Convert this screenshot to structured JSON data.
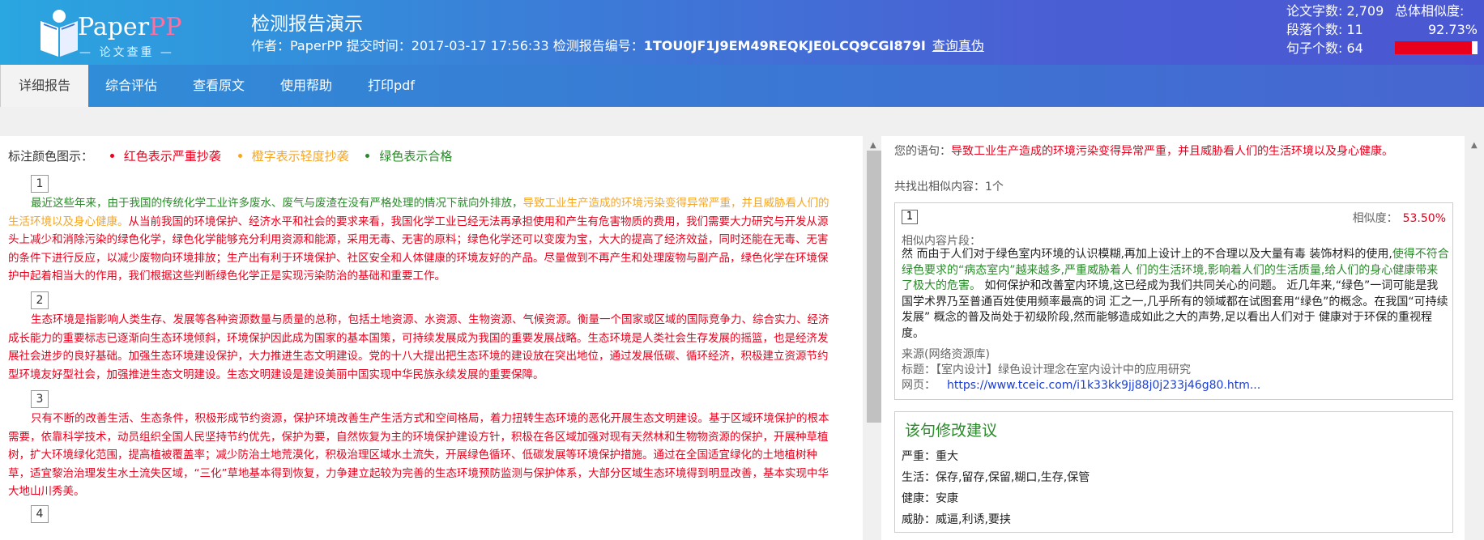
{
  "header": {
    "logo_brand_p": "P",
    "logo_brand_rest": "aper",
    "logo_brand_pp": "PP",
    "logo_tagline": "— 论文查重 —",
    "title": "检测报告演示",
    "meta_prefix": "作者：PaperPP 提交时间：2017-03-17 17:56:33 检测报告编号：",
    "report_id": "1TOU0JF1J9EM49REQKJE0LCQ9CGI879I",
    "verify_link": "查询真伪",
    "stats": {
      "word_count": "论文字数: 2,709",
      "paragraph_count": "段落个数: 11",
      "sentence_count": "句子个数: 64",
      "total_similarity_label": "总体相似度:",
      "total_similarity_value": "92.73%",
      "total_similarity_fraction": 0.9273
    },
    "colors": {
      "accent": "#3a78d4",
      "red": "#e8001c",
      "orange": "#f5a623",
      "green": "#2a8a2a"
    }
  },
  "nav": {
    "tabs": [
      "详细报告",
      "综合评估",
      "查看原文",
      "使用帮助",
      "打印pdf"
    ]
  },
  "legend": {
    "label": "标注颜色图示：",
    "red": "红色表示严重抄袭",
    "orange": "橙字表示轻度抄袭",
    "green": "绿色表示合格"
  },
  "paragraphs": [
    {
      "num": "1",
      "segments": [
        {
          "color": "green",
          "text": "最近这些年来，由于我国的传统化学工业许多废水、废气与废渣在没有严格处理的情况下就向外排放，"
        },
        {
          "color": "orange",
          "text": "导致工业生产造成的环境污染变得异常严重，并且威胁看人们的生活环境以及身心健康。"
        },
        {
          "color": "red",
          "text": "从当前我国的环境保护、经济水平和社会的要求来看，我国化学工业已经无法再承担使用和产生有危害物质的费用，我们需要大力研究与开发从源头上减少和消除污染的绿色化学，绿色化学能够充分利用资源和能源，采用无毒、无害的原料；绿色化学还可以变废为宝，大大的提高了经济效益，同时还能在无毒、无害的条件下进行反应，以减少废物向环境排放；生产出有利于环境保护、社区安全和人体健康的环境友好的产品。尽量做到不再产生和处理废物与副产品，绿色化学在环境保护中起着相当大的作用，我们根据这些判断绿色化学正是实现污染防治的基础和重要工作。"
        }
      ]
    },
    {
      "num": "2",
      "segments": [
        {
          "color": "red",
          "text": "生态环境是指影响人类生存、发展等各种资源数量与质量的总称，包括土地资源、水资源、生物资源、气候资源。衡量一个国家或区域的国际竞争力、综合实力、经济成长能力的重要标志已逐渐向生态环境倾斜，环境保护因此成为国家的基本国策，可持续发展成为我国的重要发展战略。生态环境是人类社会生存发展的摇篮，也是经济发展社会进步的良好基础。加强生态环境建设保护，大力推进生态文明建设。党的十八大提出把生态环境的建设放在突出地位，通过发展低碳、循环经济，积极建立资源节约型环境友好型社会，加强推进生态文明建设。生态文明建设是建设美丽中国实现中华民族永续发展的重要保障。"
        }
      ]
    },
    {
      "num": "3",
      "segments": [
        {
          "color": "red",
          "text": "只有不断的改善生活、生态条件，积极形成节约资源，保护环境改善生产生活方式和空间格局，着力扭转生态环境的恶化开展生态文明建设。基于区域环境保护的根本需要，依靠科学技术，动员组织全国人民坚持节约优先，保护为要，自然恢复为主的环境保护建设方针，积极在各区域加强对现有天然林和生物物资源的保护，开展种草植树，扩大环境绿化范围，提高植被覆盖率；减少防治土地荒漠化，积极治理区域水土流失，开展绿色循环、低碳发展等环境保护措施。通过在全国适宜绿化的土地植树种草，适宜黎治治理发生水土流失区域，“三化”草地基本得到恢复，力争建立起较为完善的生态环境预防监测与保护体系，大部分区域生态环境得到明显改善，基本实现中华大地山川秀美。"
        }
      ]
    },
    {
      "num": "4",
      "segments": []
    }
  ],
  "detail": {
    "sentence_label": "您的语句：",
    "sentence_text": "导致工业生产造成的环境污染变得异常严重，并且威胁看人们的生活环境以及身心健康。",
    "found_text": "共找出相似内容：1个",
    "match": {
      "num": "1",
      "similarity_label": "相似度：",
      "similarity_value": "53.50%",
      "fragment_label": "相似内容片段：",
      "fragment_segments": [
        {
          "color": "black",
          "text": "然 而由于人们对于绿色室内环境的认识模糊,再加上设计上的不合理以及大量有毒 装饰材料的使用,"
        },
        {
          "color": "green",
          "text": "使得不符合绿色要求的“病态室内”越来越多,严重威胁着人 们的生活环境,影响着人们的生活质量,给人们的身心健康带来了极大的危害。"
        },
        {
          "color": "black",
          "text": " 如何保护和改善室内环境,这已经成为我们共同关心的问题。 近几年来,“绿色”一词可能是我国学术界乃至普通百姓使用频率最高的词 汇之一,几乎所有的领域都在试图套用“绿色”的概念。在我国“可持续发展” 概念的普及尚处于初级阶段,然而能够造成如此之大的声势,足以看出人们对于 健康对于环保的重视程度。"
        }
      ],
      "source_label": "来源(网络资源库)",
      "title_label": "标题：",
      "title_value": "【室内设计】绿色设计理念在室内设计中的应用研究",
      "url_label": "网页：",
      "url_value": "https://www.tceic.com/i1k33kk9jj88j0j233j46g80.htm..."
    },
    "suggestion": {
      "heading": "该句修改建议",
      "rows": [
        "严重：重大",
        "生活：保存,留存,保留,糊口,生存,保管",
        "健康：安康",
        "威胁：威逼,利诱,要挟"
      ]
    }
  }
}
